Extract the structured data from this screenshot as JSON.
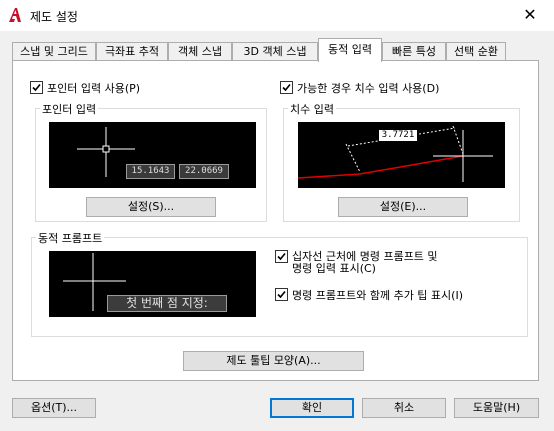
{
  "window": {
    "title": "제도 설정",
    "close_glyph": "✕"
  },
  "tabs": [
    {
      "label": "스냅 및 그리드"
    },
    {
      "label": "극좌표 추적"
    },
    {
      "label": "객체 스냅"
    },
    {
      "label": "3D 객체 스냅"
    },
    {
      "label": "동적 입력"
    },
    {
      "label": "빠른 특성"
    },
    {
      "label": "선택 순환"
    }
  ],
  "active_tab": "동적 입력",
  "pointer": {
    "enable_label": "포인터 입력 사용(P)",
    "enabled": true,
    "group_title": "포인터 입력",
    "coord_x": "15.1643",
    "coord_y": "22.0669",
    "settings_label": "설정(S)..."
  },
  "dimension": {
    "enable_label": "가능한 경우 치수 입력 사용(D)",
    "enabled": true,
    "group_title": "치수 입력",
    "value": "3.7721",
    "settings_label": "설정(E)..."
  },
  "dynamic_prompt": {
    "group_title": "동적 프롬프트",
    "prompt_text": "첫 번째 점 지정:",
    "show_prompt_label_line1": "십자선 근처에 명령 프롬프트 및",
    "show_prompt_label_line2": "명령 입력 표시(C)",
    "show_prompt_checked": true,
    "show_tips_label": "명령 프롬프트와 함께 추가 팁 표시(I)",
    "show_tips_checked": true
  },
  "tooltip_appearance_label": "제도 툴팁 모양(A)...",
  "footer": {
    "options_label": "옵션(T)...",
    "ok_label": "확인",
    "cancel_label": "취소",
    "help_label": "도움말(H)"
  },
  "colors": {
    "accent": "#0078d7",
    "app_icon": "#c8102e",
    "dimension_line": "#e00000",
    "preview_bg": "#000000"
  }
}
